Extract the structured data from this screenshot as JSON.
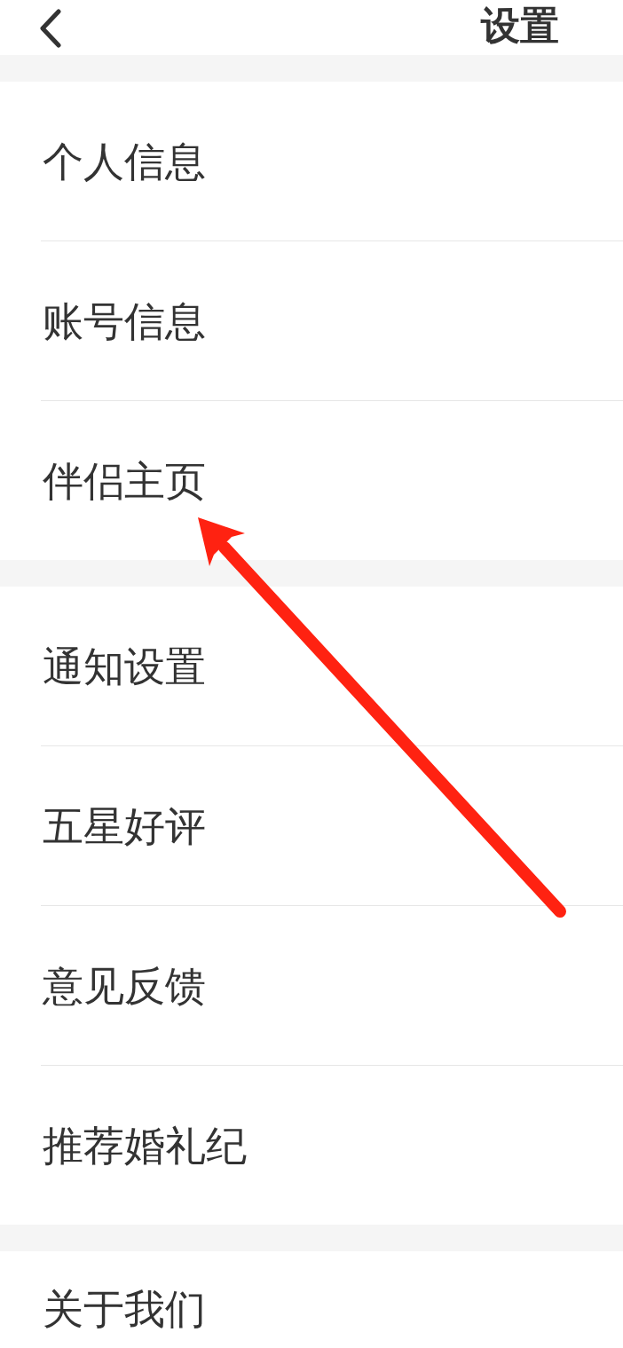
{
  "header": {
    "title": "设置"
  },
  "sections": [
    {
      "items": [
        {
          "label": "个人信息",
          "pointed_at": false
        },
        {
          "label": "账号信息",
          "pointed_at": false
        },
        {
          "label": "伴侣主页",
          "pointed_at": true
        }
      ]
    },
    {
      "items": [
        {
          "label": "通知设置",
          "pointed_at": false
        },
        {
          "label": "五星好评",
          "pointed_at": false
        },
        {
          "label": "意见反馈",
          "pointed_at": false
        },
        {
          "label": "推荐婚礼纪",
          "pointed_at": false
        }
      ]
    },
    {
      "items": [
        {
          "label": "关于我们",
          "pointed_at": false
        }
      ]
    }
  ]
}
